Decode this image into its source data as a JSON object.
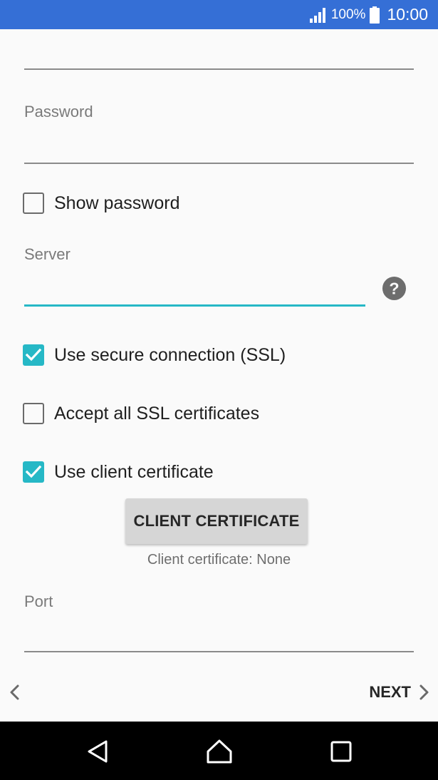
{
  "status_bar": {
    "battery_percent": "100%",
    "time": "10:00"
  },
  "form": {
    "password_label": "Password",
    "show_password_label": "Show password",
    "show_password_checked": false,
    "server_label": "Server",
    "use_ssl_label": "Use secure connection (SSL)",
    "use_ssl_checked": true,
    "accept_all_certs_label": "Accept all SSL certificates",
    "accept_all_certs_checked": false,
    "use_client_cert_label": "Use client certificate",
    "use_client_cert_checked": true,
    "client_cert_button": "CLIENT CERTIFICATE",
    "client_cert_status": "Client certificate: None",
    "port_label": "Port"
  },
  "footer": {
    "next_label": "NEXT"
  },
  "colors": {
    "status_bar": "#356fd6",
    "accent": "#26b8c6"
  }
}
